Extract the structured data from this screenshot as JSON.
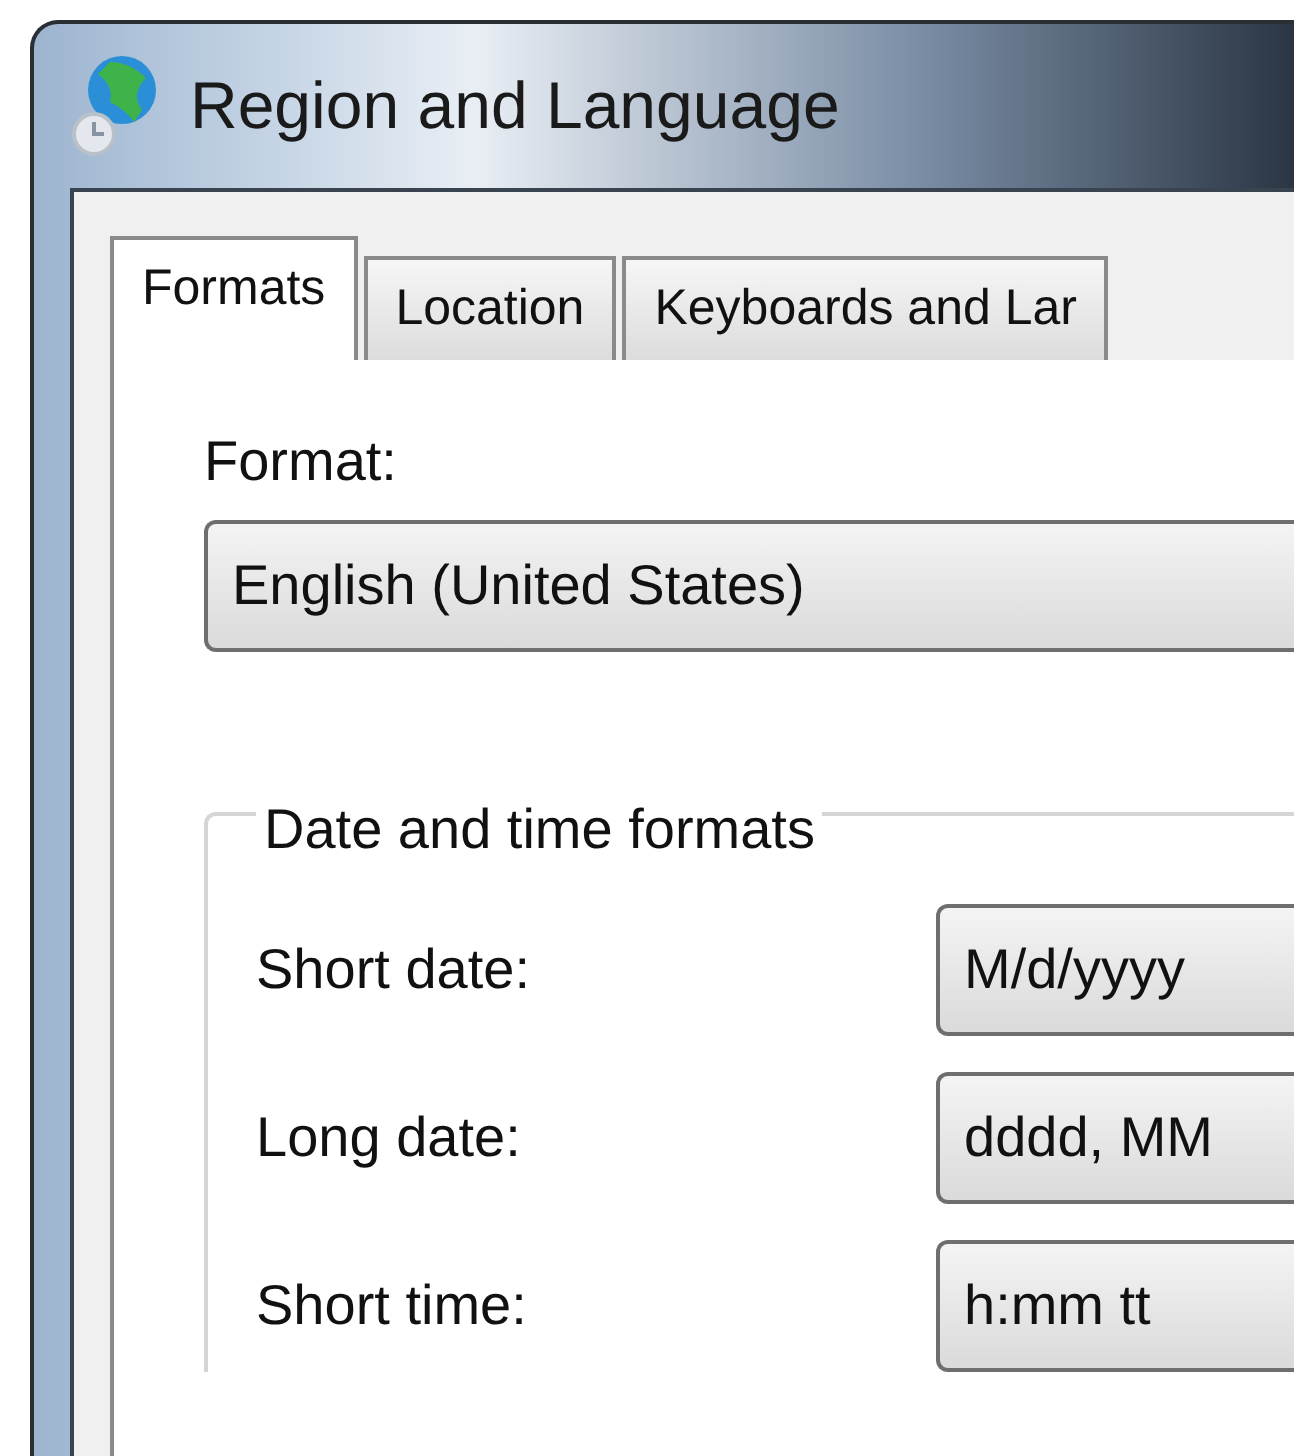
{
  "window": {
    "title": "Region and Language"
  },
  "tabs": [
    {
      "label": "Formats",
      "selected": true
    },
    {
      "label": "Location",
      "selected": false
    },
    {
      "label": "Keyboards and Lar",
      "selected": false
    }
  ],
  "format": {
    "label": "Format:",
    "value": "English (United States)"
  },
  "date_time_formats": {
    "legend": "Date and time formats",
    "rows": [
      {
        "label": "Short date:",
        "value": "M/d/yyyy"
      },
      {
        "label": "Long date:",
        "value": "dddd, MM"
      },
      {
        "label": "Short time:",
        "value": "h:mm tt"
      }
    ]
  }
}
